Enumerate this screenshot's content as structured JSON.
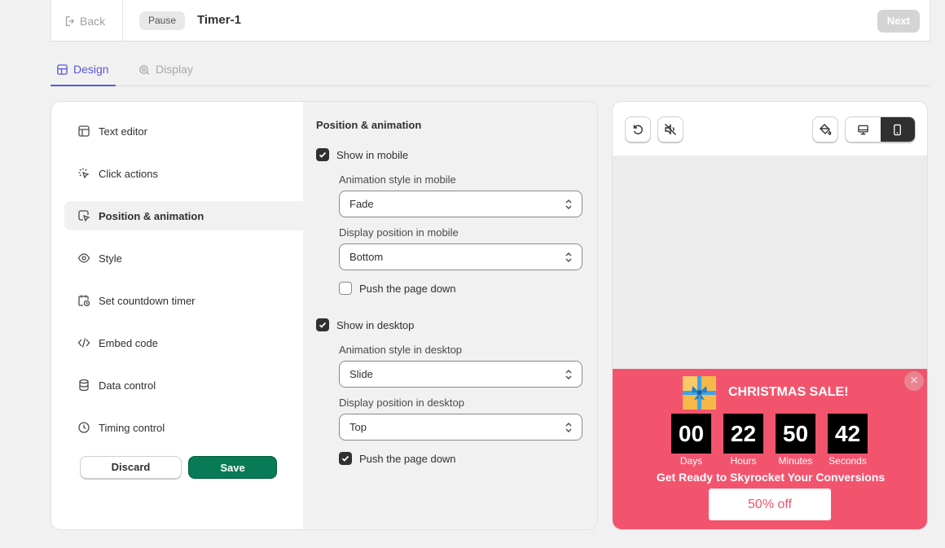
{
  "header": {
    "back_label": "Back",
    "pause_label": "Pause",
    "title": "Timer-1",
    "next_label": "Next"
  },
  "tabs": [
    {
      "label": "Design",
      "active": true
    },
    {
      "label": "Display",
      "active": false
    }
  ],
  "menu": {
    "items": [
      {
        "label": "Text editor",
        "icon": "layout-icon"
      },
      {
        "label": "Click actions",
        "icon": "cursor-click-icon"
      },
      {
        "label": "Position & animation",
        "icon": "cursor-box-icon",
        "active": true
      },
      {
        "label": "Style",
        "icon": "eye-icon"
      },
      {
        "label": "Set countdown timer",
        "icon": "calendar-clock-icon"
      },
      {
        "label": "Embed code",
        "icon": "code-icon"
      },
      {
        "label": "Data control",
        "icon": "database-icon"
      },
      {
        "label": "Timing control",
        "icon": "clock-icon"
      }
    ],
    "discard_label": "Discard",
    "save_label": "Save"
  },
  "settings": {
    "heading": "Position & animation",
    "mobile": {
      "show_label": "Show in mobile",
      "show_checked": true,
      "animation_label": "Animation style in mobile",
      "animation_value": "Fade",
      "position_label": "Display position in mobile",
      "position_value": "Bottom",
      "push_label": "Push the page down",
      "push_checked": false
    },
    "desktop": {
      "show_label": "Show in desktop",
      "show_checked": true,
      "animation_label": "Animation style in desktop",
      "animation_value": "Slide",
      "position_label": "Display position in desktop",
      "position_value": "Top",
      "push_label": "Push the page down",
      "push_checked": true
    }
  },
  "preview": {
    "title": "CHRISTMAS SALE!",
    "days": "00",
    "hours": "22",
    "minutes": "50",
    "seconds": "42",
    "days_label": "Days",
    "hours_label": "Hours",
    "minutes_label": "Minutes",
    "seconds_label": "Seconds",
    "tagline": "Get Ready to Skyrocket Your Conversions",
    "cta_label": "50% off",
    "close_glyph": "×",
    "bar_color": "#f2546e"
  },
  "colors": {
    "accent": "#5b58d6",
    "save": "#087a55"
  }
}
